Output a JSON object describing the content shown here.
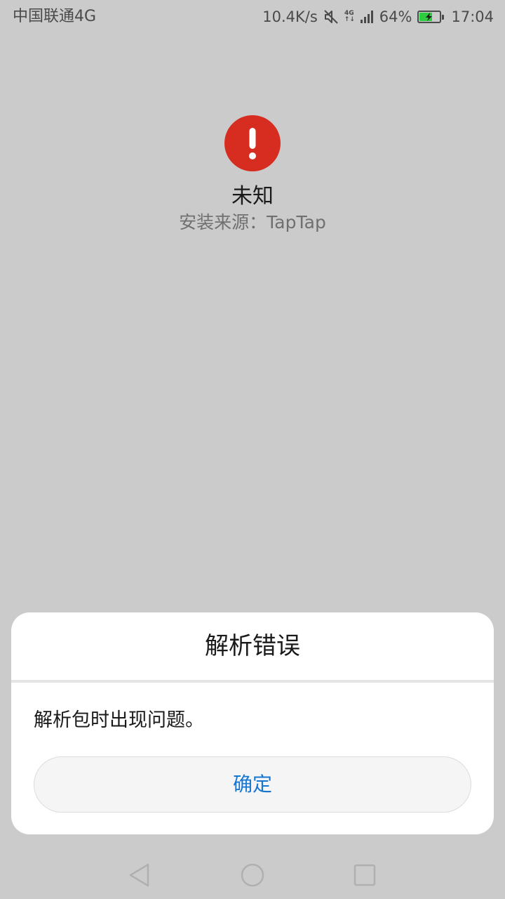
{
  "status_bar": {
    "carrier": "中国联通4G",
    "speed": "10.4K/s",
    "net_badge_top": "4G",
    "net_badge_bottom": "↑↓",
    "battery_percent": "64%",
    "battery_level": 0.64,
    "time": "17:04",
    "battery_color": "#2ecc40"
  },
  "app": {
    "icon": "exclamation-icon",
    "icon_color": "#d62d20",
    "name": "未知",
    "install_source": "安装来源：TapTap"
  },
  "dialog": {
    "title": "解析错误",
    "message": "解析包时出现问题。",
    "ok_label": "确定",
    "accent_color": "#1677d2"
  },
  "nav_bar": {
    "back_icon": "back-triangle-icon",
    "home_icon": "home-circle-icon",
    "recent_icon": "recent-square-icon"
  }
}
